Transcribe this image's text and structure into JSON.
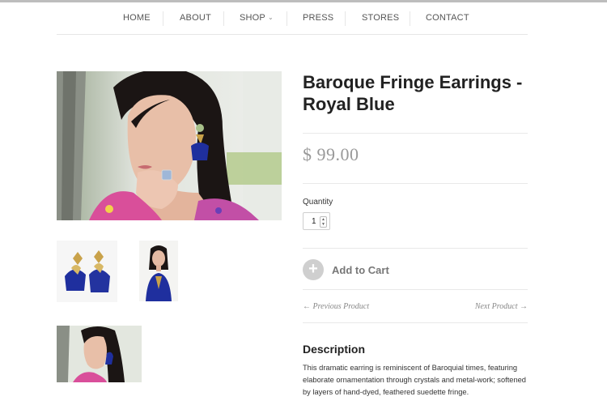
{
  "nav": {
    "items": [
      {
        "label": "HOME"
      },
      {
        "label": "ABOUT"
      },
      {
        "label": "SHOP"
      },
      {
        "label": "PRESS"
      },
      {
        "label": "STORES"
      },
      {
        "label": "CONTACT"
      }
    ],
    "shop_dropdown_icon": "chevron-down-icon"
  },
  "product": {
    "title": "Baroque Fringe Earrings - Royal Blue",
    "price": "$ 99.00",
    "quantity_label": "Quantity",
    "quantity_value": "1",
    "add_to_cart": "Add to Cart",
    "add_to_cart_icon": "plus-icon",
    "prev_link": "← Previous Product",
    "next_link": "Next Product →",
    "description_title": "Description",
    "description": "This dramatic earring is reminiscent of Baroquial times, featuring elaborate ornamentation through crystals and metal-work; softened by layers of hand-dyed, feathered suedette fringe."
  },
  "colors": {
    "royal_blue": "#1f2f9e",
    "gold": "#c9a24a",
    "button_grey": "#cfcfcf"
  }
}
